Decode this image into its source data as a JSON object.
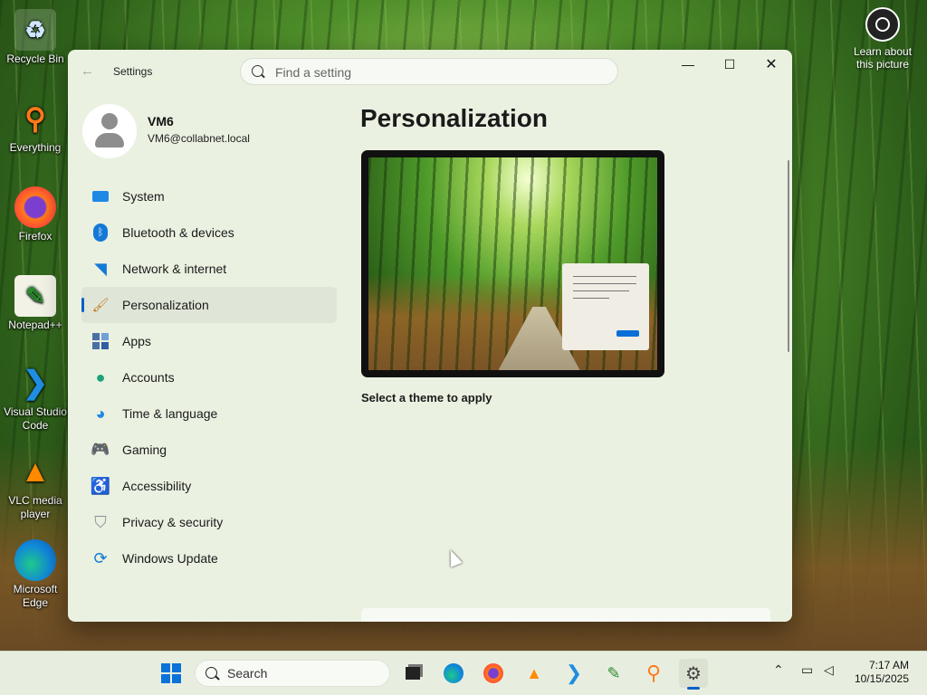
{
  "desktop": {
    "icons": [
      {
        "label": "Recycle Bin"
      },
      {
        "label": "Everything"
      },
      {
        "label": "Firefox"
      },
      {
        "label": "Notepad++"
      },
      {
        "label_line1": "Visual Studio",
        "label_line2": "Code"
      },
      {
        "label_line1": "VLC media",
        "label_line2": "player"
      },
      {
        "label_line1": "Microsoft",
        "label_line2": "Edge"
      }
    ],
    "learn_line1": "Learn about",
    "learn_line2": "this picture"
  },
  "window": {
    "title": "Settings",
    "search_placeholder": "Find a setting",
    "minimize": "—",
    "maximize": "☐",
    "close": "✕"
  },
  "profile": {
    "name": "VM6",
    "email": "VM6@collabnet.local"
  },
  "nav": {
    "items": [
      {
        "label": "System",
        "icon": "system-icon"
      },
      {
        "label": "Bluetooth & devices",
        "icon": "bluetooth-icon"
      },
      {
        "label": "Network & internet",
        "icon": "wifi-icon"
      },
      {
        "label": "Personalization",
        "icon": "brush-icon",
        "active": true
      },
      {
        "label": "Apps",
        "icon": "apps-icon"
      },
      {
        "label": "Accounts",
        "icon": "accounts-icon"
      },
      {
        "label": "Time & language",
        "icon": "globe-clock-icon"
      },
      {
        "label": "Gaming",
        "icon": "gamepad-icon"
      },
      {
        "label": "Accessibility",
        "icon": "accessibility-icon"
      },
      {
        "label": "Privacy & security",
        "icon": "shield-icon"
      },
      {
        "label": "Windows Update",
        "icon": "update-icon"
      }
    ]
  },
  "content": {
    "title": "Personalization",
    "theme_prompt": "Select a theme to apply"
  },
  "taskbar": {
    "search_placeholder": "Search",
    "time": "7:17 AM",
    "date": "10/15/2025"
  },
  "colors": {
    "accent": "#0a5fc7",
    "window_bg": "#eaf1e1"
  }
}
